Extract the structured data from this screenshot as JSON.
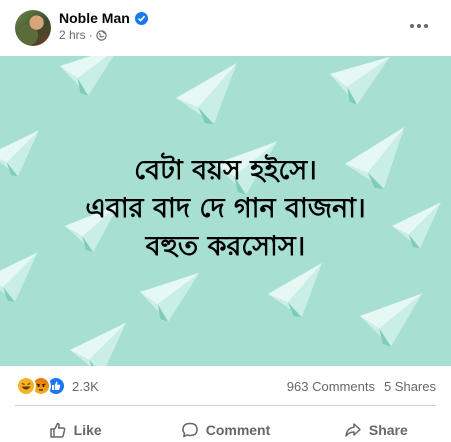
{
  "post": {
    "author": "Noble Man",
    "time": "2 hrs",
    "separator": "·",
    "image_text": {
      "line1": "বেটা বয়স হইসে।",
      "line2": "এবার বাদ দে গান বাজনা।",
      "line3": "বহুত করসোস।"
    }
  },
  "stats": {
    "reaction_count": "2.3K",
    "comments": "963 Comments",
    "shares": "5 Shares",
    "reactions": [
      "haha",
      "angry",
      "like"
    ]
  },
  "actions": {
    "like_label": "Like",
    "comment_label": "Comment",
    "share_label": "Share"
  },
  "colors": {
    "image_background": "#a8dfd3",
    "verified": "#1877f2",
    "muted_text": "#65676b"
  },
  "icons": [
    "verified-badge-icon",
    "globe-icon",
    "more-options-icon",
    "haha-icon",
    "angry-icon",
    "like-reaction-icon",
    "like-icon",
    "comment-icon",
    "share-icon"
  ]
}
